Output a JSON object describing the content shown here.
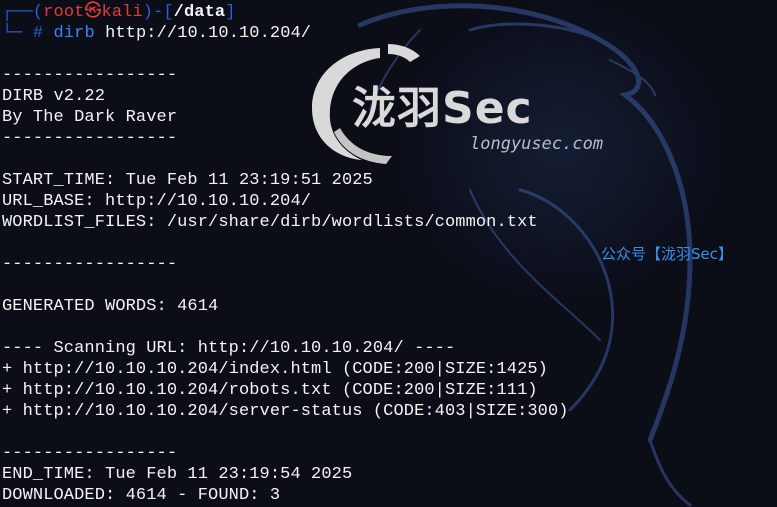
{
  "prompt": {
    "frame_top": "┌──(",
    "user": "root",
    "at_symbol": "㉿",
    "host": "kali",
    "bracket_mid": ")-[",
    "path": "/data",
    "bracket_end": "]",
    "frame_bottom": "└─",
    "hash": "#"
  },
  "command": {
    "name": "dirb",
    "arg": "http://10.10.10.204/"
  },
  "output": {
    "sep1": "-----------------",
    "version": "DIRB v2.22",
    "author": "By The Dark Raver",
    "sep2": "-----------------",
    "start_time": "START_TIME: Tue Feb 11 23:19:51 2025",
    "url_base": "URL_BASE: http://10.10.10.204/",
    "wordlist": "WORDLIST_FILES: /usr/share/dirb/wordlists/common.txt",
    "sep3": "-----------------",
    "generated": "GENERATED WORDS: 4614",
    "scanning": "---- Scanning URL: http://10.10.10.204/ ----",
    "results": [
      "+ http://10.10.10.204/index.html (CODE:200|SIZE:1425)",
      "+ http://10.10.10.204/robots.txt (CODE:200|SIZE:111)",
      "+ http://10.10.10.204/server-status (CODE:403|SIZE:300)"
    ],
    "sep4": "-----------------",
    "end_time": "END_TIME: Tue Feb 11 23:19:54 2025",
    "downloaded": "DOWNLOADED: 4614 - FOUND: 3"
  },
  "watermark": {
    "logo_text": "泷羽Sec",
    "domain": "longyusec.com",
    "wechat": "公众号【泷羽Sec】"
  },
  "colors": {
    "background": "#0b0d17",
    "text": "#f4f4f4",
    "prompt_blue": "#2a5fd6",
    "prompt_red": "#e03b3b",
    "command_blue": "#3b82f6",
    "watermark_gray": "#d9d9d9",
    "wechat_blue": "#3a8fe8"
  },
  "icons": {
    "background": "kali-dragon-icon",
    "logo": "longyu-sec-logo-icon"
  }
}
